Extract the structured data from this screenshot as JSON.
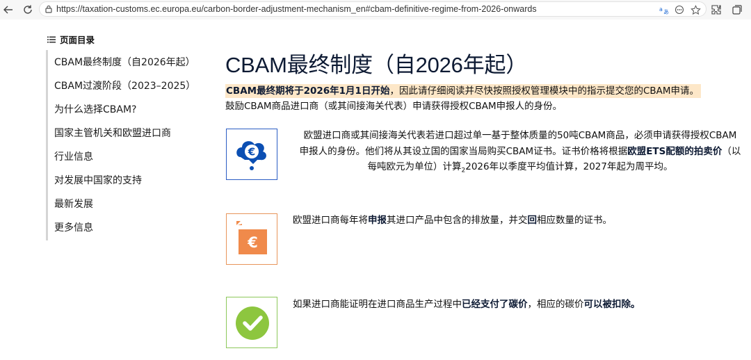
{
  "browser": {
    "url": "https://taxation-customs.ec.europa.eu/carbon-border-adjustment-mechanism_en#cbam-definitive-regime-from-2026-onwards"
  },
  "toc": {
    "title": "页面目录",
    "items": [
      {
        "label": "CBAM最终制度（自2026年起）"
      },
      {
        "label": "CBAM过渡阶段（2023–2025）"
      },
      {
        "label": "为什么选择CBAM?"
      },
      {
        "label": "国家主管机关和欧盟进口商"
      },
      {
        "label": "行业信息"
      },
      {
        "label": "对发展中国家的支持"
      },
      {
        "label": "最新发展"
      },
      {
        "label": "更多信息"
      }
    ]
  },
  "main": {
    "heading": "CBAM最终制度（自2026年起）",
    "intro": {
      "bold": "CBAM最终期将于2026年1月1日开始",
      "rest": "，因此请仔细阅读并尽快按照授权管理模块中的指示提交您的CBAM申请。",
      "line2": "鼓励CBAM商品进口商（或其间接海关代表）申请获得授权CBAM申报人的身份。"
    },
    "cards": [
      {
        "icon": "euro-cloud-icon",
        "l1": "欧盟进口商或其间接海关代表若进口超过单一基于整体质量的50吨CBAM商品，必须申请获得授权CBAM",
        "l2a": "申报人的身份。他们将从其设立国的国家当局购买CBAM证书。证书价格将根据",
        "l2b": "欧盟ETS配额的拍卖价",
        "l2c": "（以",
        "l3a": "每吨欧元为单位）计算",
        "l3sub": "2",
        "l3b": "2026年以季度平均值计算，2027年起为周平均。"
      },
      {
        "icon": "euro-document-icon",
        "t1": "欧盟进口商每年将",
        "b1": "申报",
        "t2": "其进口产品中包含的排放量，并交",
        "b2": "回",
        "t3": "相应数量的证书。"
      },
      {
        "icon": "checkmark-circle-icon",
        "t1": "如果进口商能证明在进口商品生产过程中",
        "b1": "已经支付了碳价",
        "t2": "，相应的碳价",
        "b2": "可以被扣除。"
      }
    ]
  },
  "colors": {
    "blue": "#0b4fb3",
    "orange": "#f08a4b",
    "green": "#8dc63f",
    "highlight": "#fde7c8"
  }
}
